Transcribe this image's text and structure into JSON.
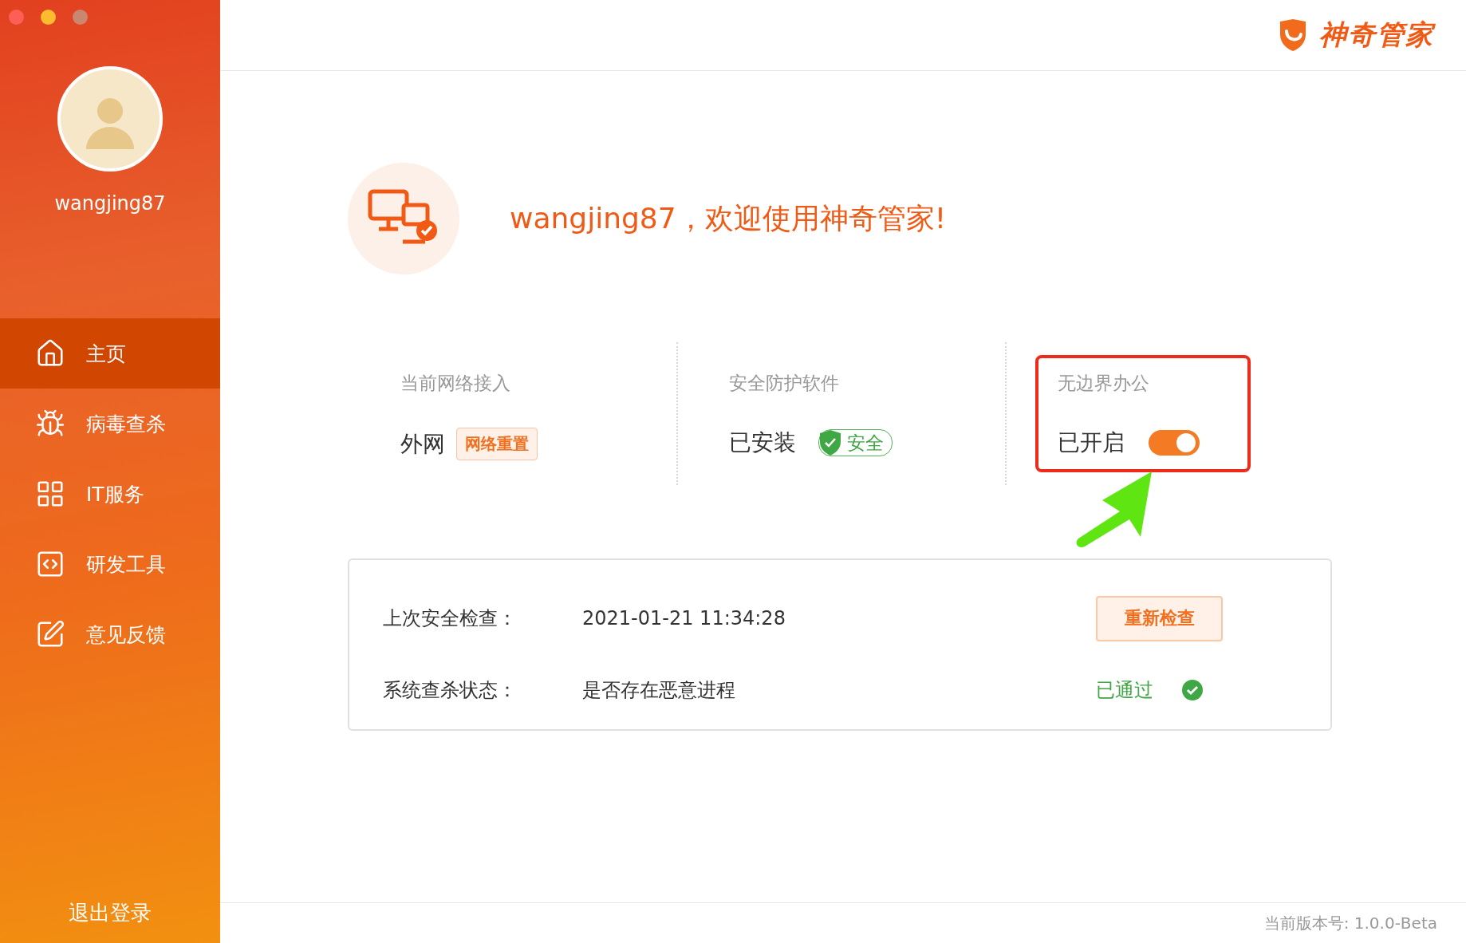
{
  "header": {
    "logo_text": "神奇管家"
  },
  "sidebar": {
    "username": "wangjing87",
    "items": [
      {
        "label": "主页",
        "kind": "home",
        "selected": true
      },
      {
        "label": "病毒查杀",
        "kind": "bug",
        "selected": false
      },
      {
        "label": "IT服务",
        "kind": "grid",
        "selected": false
      },
      {
        "label": "研发工具",
        "kind": "code",
        "selected": false
      },
      {
        "label": "意见反馈",
        "kind": "feedback",
        "selected": false
      }
    ],
    "logout": "退出登录"
  },
  "welcome": "wangjing87，欢迎使用神奇管家!",
  "status": [
    {
      "kind": "tag",
      "title": "当前网络接入",
      "value": "外网",
      "tag": "网络重置",
      "highlighted": false
    },
    {
      "kind": "badge",
      "title": "安全防护软件",
      "value": "已安装",
      "badge": "安全",
      "highlighted": false
    },
    {
      "kind": "switch",
      "title": "无边界办公",
      "value": "已开启",
      "on": true,
      "highlighted": true
    }
  ],
  "check_card": {
    "rows": [
      {
        "kind": "button",
        "label": "上次安全检查：",
        "value": "2021-01-21 11:34:28",
        "action": "重新检查"
      },
      {
        "kind": "result",
        "label": "系统查杀状态：",
        "value": "是否存在恶意进程",
        "result": "已通过"
      }
    ]
  },
  "version": "当前版本号: 1.0.0-Beta"
}
